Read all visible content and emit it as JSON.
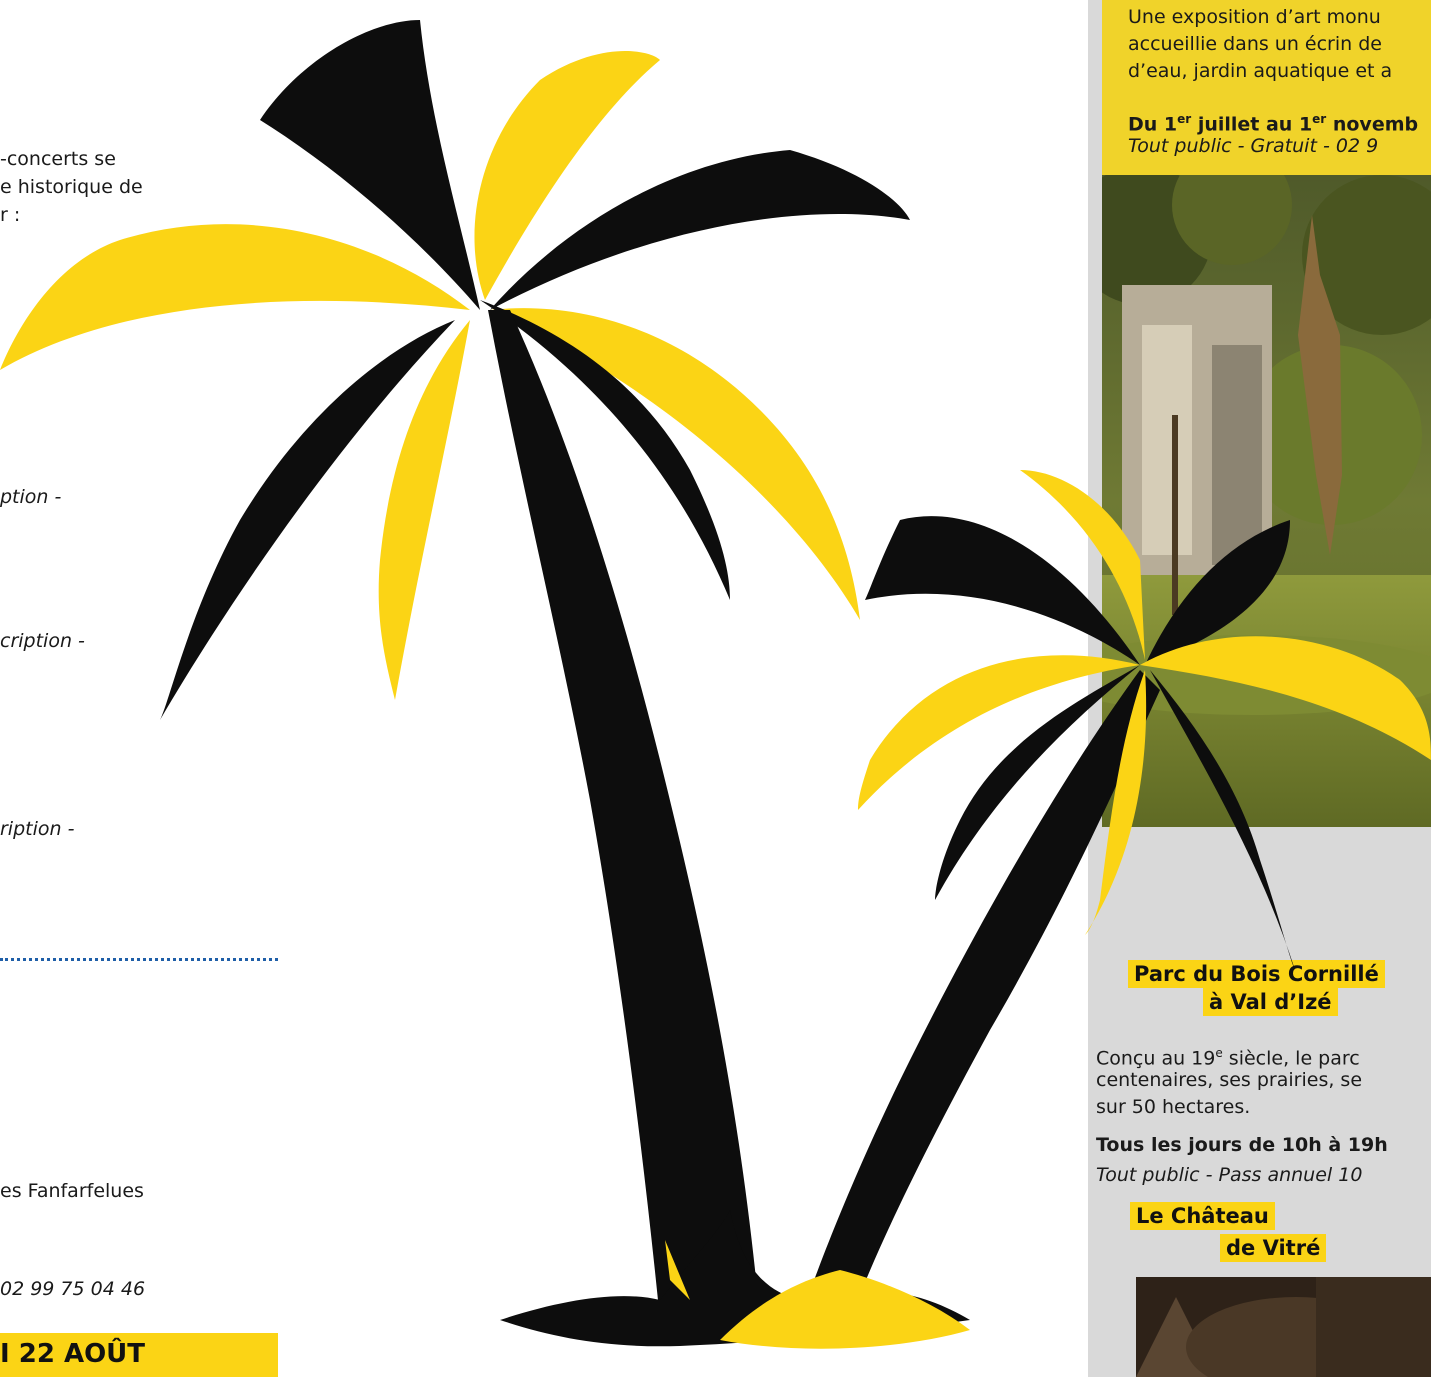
{
  "left": {
    "fragments": [
      {
        "id": "concerts-1",
        "text": "-concerts se"
      },
      {
        "id": "concerts-2",
        "text": "e historique de"
      },
      {
        "id": "concerts-3",
        "text": "r :"
      },
      {
        "id": "inscription-1",
        "text": "ption -"
      },
      {
        "id": "inscription-2",
        "text": "cription -"
      },
      {
        "id": "inscription-3",
        "text": "ription -"
      },
      {
        "id": "fanfarfelues",
        "text": "es Fanfarfelues"
      },
      {
        "id": "phone",
        "text": "02 99 75 04 46"
      }
    ],
    "date_banner": "I 22 AOÛT"
  },
  "right": {
    "expo": {
      "line1": "Une exposition d’art monu",
      "line2": "accueillie dans un écrin de",
      "line3": "d’eau, jardin aquatique et a",
      "dates_a": "Du 1",
      "dates_sup1": "er",
      "dates_b": " juillet au 1",
      "dates_sup2": "er",
      "dates_c": " novemb",
      "info": "Tout public - Gratuit - 02 9"
    },
    "parc": {
      "heading_line1": "Parc du Bois Cornillé",
      "heading_line2": "à Val d’Izé",
      "desc1_a": "Conçu au 19",
      "desc1_sup": "e",
      "desc1_b": " siècle, le parc",
      "desc2": "centenaires, ses prairies, se",
      "desc3": "sur 50 hectares.",
      "hours": "Tous les jours de 10h à 19h",
      "info": "Tout public - Pass annuel 10"
    },
    "chateau": {
      "heading_line1": "Le Château",
      "heading_line2": "de Vitré"
    }
  },
  "colors": {
    "yellow": "#fbd415",
    "black": "#0d0d0d",
    "grey": "#d9d9d9",
    "accent_blue": "#1f5fa8"
  }
}
